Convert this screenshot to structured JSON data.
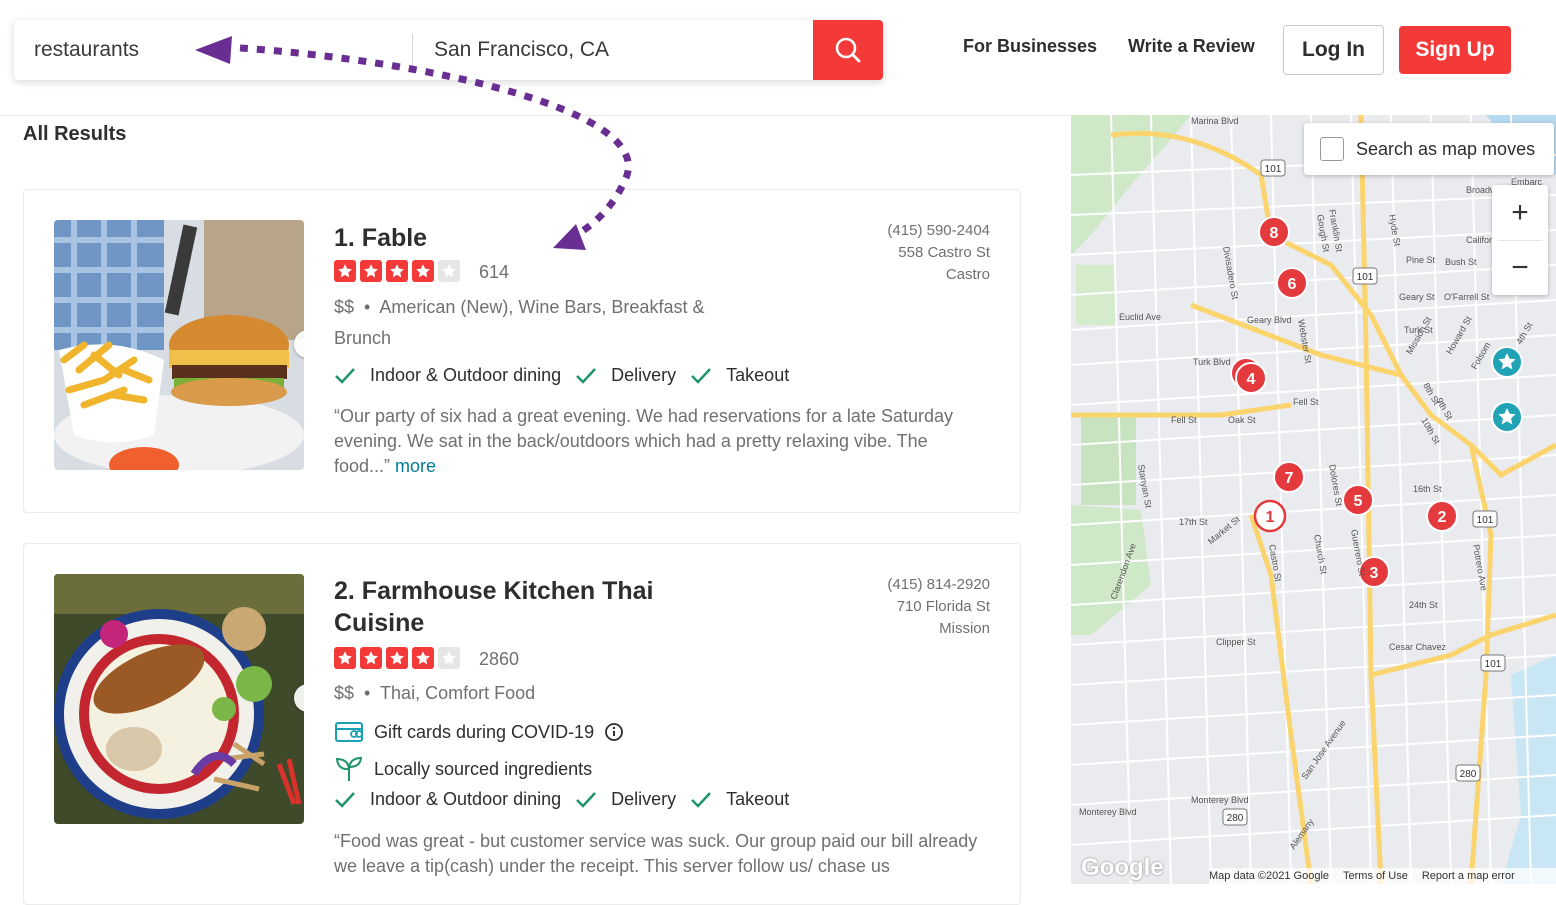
{
  "search": {
    "find_value": "restaurants",
    "near_value": "San Francisco, CA"
  },
  "header": {
    "for_businesses": "For Businesses",
    "write_review": "Write a Review",
    "login": "Log In",
    "signup": "Sign Up"
  },
  "results_title": "All Results",
  "results": [
    {
      "name": "1. Fable",
      "rating": 4,
      "review_count": "614",
      "price": "$$",
      "categories": "American (New), Wine Bars, Breakfast & Brunch",
      "phone": "(415) 590-2404",
      "address": "558 Castro St",
      "neighborhood": "Castro",
      "amenities": [
        "Indoor & Outdoor dining",
        "Delivery",
        "Takeout"
      ],
      "snippet": "“Our party of six had a great evening. We had reservations for a late Saturday evening. We sat in the back/outdoors which had a pretty relaxing vibe. The food...”",
      "more": "more"
    },
    {
      "name": "2. Farmhouse Kitchen Thai Cuisine",
      "rating": 4,
      "review_count": "2860",
      "price": "$$",
      "categories": "Thai, Comfort Food",
      "phone": "(415) 814-2920",
      "address": "710 Florida St",
      "neighborhood": "Mission",
      "features": [
        "Gift cards during COVID-19",
        "Locally sourced ingredients"
      ],
      "amenities": [
        "Indoor & Outdoor dining",
        "Delivery",
        "Takeout"
      ],
      "snippet": "“Food was great - but customer service was suck. Our group paid our bill already we leave a tip(cash) under the receipt. This server follow us/ chase us"
    }
  ],
  "map": {
    "search_as_moves": "Search as map moves",
    "zoom_in": "+",
    "zoom_out": "−",
    "footer": [
      "Map data ©2021 Google",
      "Terms of Use",
      "Report a map error"
    ],
    "logo": "Google",
    "markers": [
      "1",
      "2",
      "3",
      "4",
      "5",
      "6",
      "7",
      "8"
    ],
    "labels": [
      "Marina Blvd",
      "Broadway",
      "Embarc",
      "Franklin St",
      "Gough St",
      "Hyde St",
      "California",
      "Pine St",
      "Bush St",
      "Geary St",
      "O'Farrell St",
      "Turk St",
      "Euclid Ave",
      "Geary Blvd",
      "Divisadero St",
      "Webster St",
      "Turk Blvd",
      "Fell St",
      "Oak St",
      "Mission St",
      "Howard St",
      "Folsom",
      "8th St",
      "9th St",
      "10th St",
      "4th St",
      "Stanyan St",
      "17th St",
      "Market St",
      "Castro St",
      "Church St",
      "Dolores St",
      "Guerrero St",
      "16th St",
      "Potrero Ave",
      "24th St",
      "Cesar Chavez",
      "Clarendon Ave",
      "Clipper St",
      "San Jose Avenue",
      "Monterey Blvd",
      "Alemany"
    ],
    "shields": [
      "101",
      "101",
      "101",
      "101",
      "280",
      "280"
    ],
    "colors": {
      "marker": "#e4393d",
      "star_marker": "#1fa3b5",
      "road": "#fbd46e"
    }
  },
  "colors": {
    "brand": "#f43939",
    "link": "#027a97",
    "check": "#1c9469",
    "annotation_arrow": "#6a2d91"
  }
}
